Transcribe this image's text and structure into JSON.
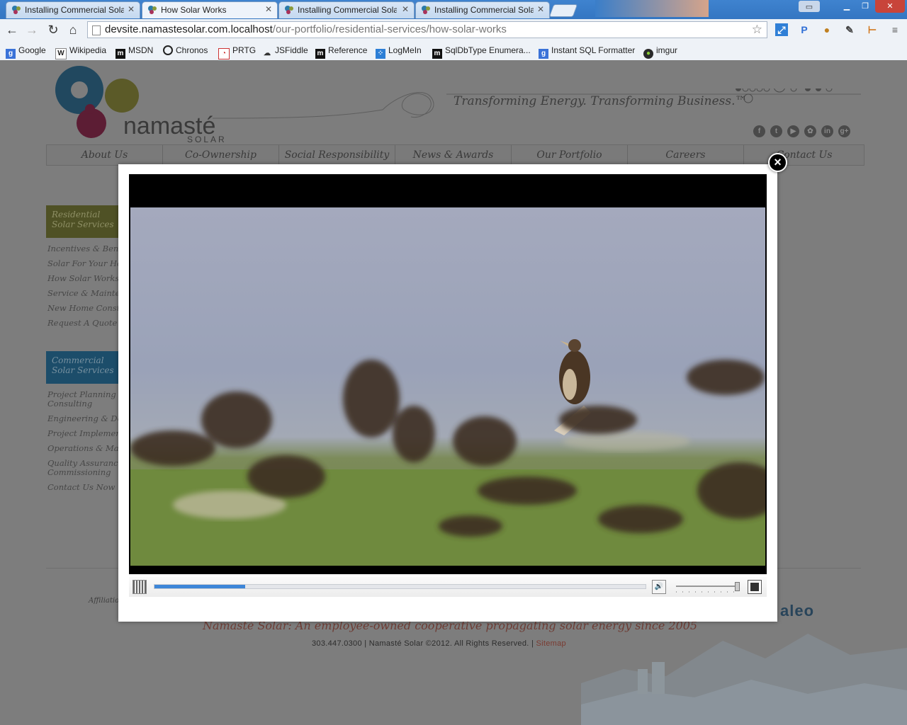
{
  "browser": {
    "tabs": [
      {
        "title": "Installing Commercial Solar Pow",
        "active": false
      },
      {
        "title": "How Solar Works",
        "active": true
      },
      {
        "title": "Installing Commercial Solar Pow",
        "active": false
      },
      {
        "title": "Installing Commercial Solar Pow",
        "active": false
      }
    ],
    "url_host": "devsite.namastesolar.com.localhost",
    "url_path": "/our-portfolio/residential-services/how-solar-works",
    "bookmarks": [
      "Google",
      "Wikipedia",
      "MSDN",
      "Chronos",
      "PRTG",
      "JSFiddle",
      "Reference",
      "LogMeIn",
      "SqlDbType Enumera...",
      "Instant SQL Formatter",
      "imgur"
    ],
    "extension_icons": [
      "resize-icon",
      "p-icon",
      "cookie-icon",
      "eyedropper-icon",
      "ruler-icon",
      "menu-icon"
    ]
  },
  "site": {
    "logo_word": "namasté",
    "logo_sub": "SOLAR",
    "tagline": "Transforming Energy. Transforming Business.™",
    "social_icons": [
      "facebook-icon",
      "twitter-icon",
      "youtube-icon",
      "flickr-icon",
      "linkedin-icon",
      "google-plus-icon"
    ],
    "nav": [
      "About Us",
      "Co-Ownership",
      "Social Responsibility",
      "News & Awards",
      "Our Portfolio",
      "Careers",
      "Contact Us"
    ],
    "residential": {
      "heading": [
        "Residential",
        "Solar Services"
      ],
      "links": [
        "Incentives & Benefits",
        "Solar For Your Home",
        "How Solar Works",
        "Service & Maintenance",
        "New Home Construction",
        "Request A Quote"
      ]
    },
    "commercial": {
      "heading": [
        "Commercial",
        "Solar Services"
      ],
      "links": [
        [
          "Project Planning &",
          "Consulting"
        ],
        [
          "Engineering & Design"
        ],
        [
          "Project Implementation"
        ],
        [
          "Operations & Maintenance"
        ],
        [
          "Quality Assurance &",
          "Commissioning"
        ],
        [
          "Contact Us Now"
        ]
      ]
    },
    "affiliations_label": "Affiliations",
    "partner_logo": "aleo",
    "motto": "Namasté Solar: An employee-owned cooperative propagating solar energy since 2005",
    "copyright": "303.447.0300 | Namasté Solar ©2012. All Rights Reserved. |",
    "sitemap": "Sitemap"
  },
  "player": {
    "progress_fraction": 0.185,
    "volume_fraction": 0.95,
    "close_label": "×"
  },
  "colors": {
    "seek_fill": "#3d86d8",
    "nav_text": "#3a3a3a",
    "sitemap_link": "#7a3a30"
  }
}
